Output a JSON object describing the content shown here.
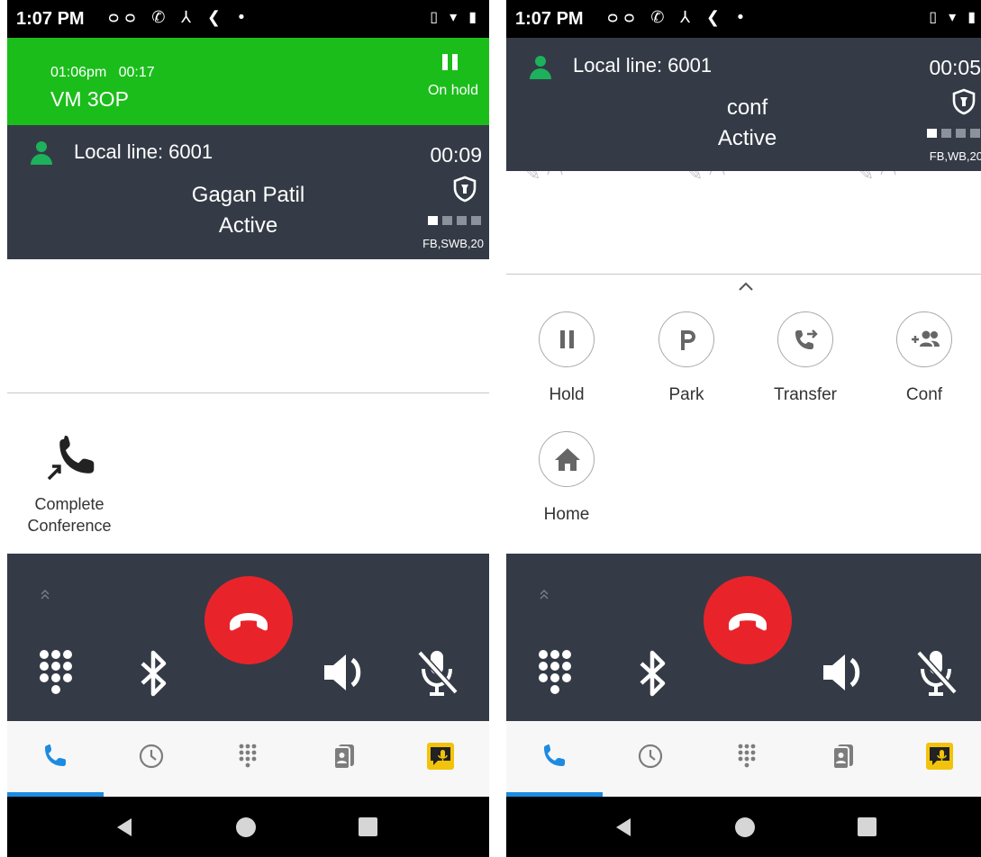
{
  "left": {
    "status_bar": {
      "time": "1:07 PM",
      "left_icons": "ᴑᴑ ✆ ⅄ ❮ •",
      "right_icons": "▯ ▾ ▮"
    },
    "held_call": {
      "start_time": "01:06pm",
      "duration": "00:17",
      "name": "VM 3OP",
      "status": "On hold",
      "color": "#1bbd1b"
    },
    "active_call": {
      "line": "Local line: 6001",
      "timer": "00:09",
      "name": "Gagan Patil",
      "state": "Active",
      "signal_bars": 4,
      "signal_active": 1,
      "codec": "FB,SWB,20"
    },
    "complete_conference": {
      "label_line1": "Complete",
      "label_line2": "Conference"
    },
    "controls": [
      "dialpad-icon",
      "bluetooth-icon",
      "hangup-icon",
      "speaker-icon",
      "mute-icon"
    ],
    "tabs": [
      "calls",
      "history",
      "dialpad",
      "contacts",
      "voicemail"
    ],
    "active_tab": "calls"
  },
  "right": {
    "status_bar": {
      "time": "1:07 PM",
      "left_icons": "ᴑᴑ ✆ ⅄ ❮ •",
      "right_icons": "▯ ▾ ▮"
    },
    "active_call": {
      "line": "Local line: 6001",
      "timer": "00:05",
      "name": "conf",
      "state": "Active",
      "signal_bars": 4,
      "signal_active": 1,
      "codec": "FB,WB,20"
    },
    "actions": [
      {
        "label": "Hold",
        "icon": "pause-icon"
      },
      {
        "label": "Park",
        "icon": "park-icon"
      },
      {
        "label": "Transfer",
        "icon": "transfer-icon"
      },
      {
        "label": "Conf",
        "icon": "add-conference-icon"
      },
      {
        "label": "Home",
        "icon": "home-icon"
      }
    ],
    "controls": [
      "dialpad-icon",
      "bluetooth-icon",
      "hangup-icon",
      "speaker-icon",
      "mute-icon"
    ],
    "tabs": [
      "calls",
      "history",
      "dialpad",
      "contacts",
      "voicemail"
    ],
    "active_tab": "calls"
  },
  "colors": {
    "accent": "#1d8be0",
    "hangup": "#e8242a",
    "card": "#343b46",
    "hold": "#1bbd1b",
    "voicemail": "#f2c30c"
  }
}
